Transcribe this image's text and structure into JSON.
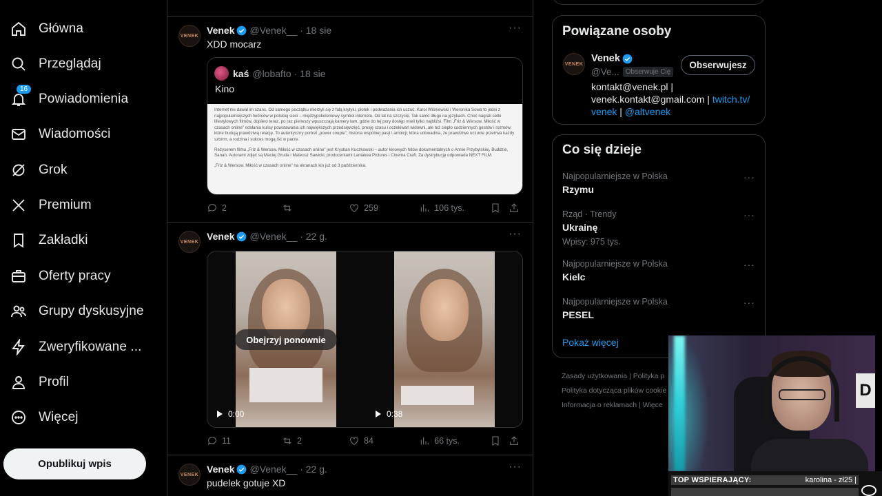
{
  "nav": {
    "items": [
      {
        "label": "Główna",
        "icon": "home-icon"
      },
      {
        "label": "Przeglądaj",
        "icon": "search-icon"
      },
      {
        "label": "Powiadomienia",
        "icon": "bell-icon",
        "badge": "16"
      },
      {
        "label": "Wiadomości",
        "icon": "mail-icon"
      },
      {
        "label": "Grok",
        "icon": "grok-icon"
      },
      {
        "label": "Premium",
        "icon": "x-logo-icon"
      },
      {
        "label": "Zakładki",
        "icon": "bookmark-icon"
      },
      {
        "label": "Oferty pracy",
        "icon": "briefcase-icon"
      },
      {
        "label": "Grupy dyskusyjne",
        "icon": "people-icon"
      },
      {
        "label": "Zweryfikowane ...",
        "icon": "lightning-icon"
      },
      {
        "label": "Profil",
        "icon": "person-icon"
      },
      {
        "label": "Więcej",
        "icon": "more-circle-icon"
      }
    ],
    "publish_label": "Opublikuj wpis"
  },
  "tweets": [
    {
      "avatar_text": "VENEK",
      "name": "Venek",
      "handle": "@Venek__",
      "time": "· 18 sie",
      "text": "XDD mocarz",
      "quote": {
        "name": "kaś",
        "handle": "@lobafto",
        "time": "· 18 sie",
        "text": "Kino",
        "doc_p1": "Internet nie dawał im szans. Od samego początku mierzyli się z falą krytyki, plotek i podważania ich uczuć. Karol Wiśniewski i Weronika Sowa to jedni z najpopularniejszych twórców w polskiej sieci – międzypokoleniowy symbol internetu. Od lat na szczycie. Tak samo długo na językach. Choć nagrali setki lifestylowych filmów, dopiero teraz, po raz pierwszy wpuszczają kamery tam, gdzie do tej pory dostęp mieli tylko najbliżsi. Film „Friz & Wersow. Miłość w czasach online” odsłania kulisy powstawania ich największych przedsięwzięć, presję czasu i oczekiwań widowni, ale też ciepło codziennych gestów i rozmów, które budują prawdziwą relację. To autentyczny portret „power couple”, historia wspólnej pasji i ambicji, która udowadnia, że prawdziwe uczucie przetrwa każdy sztorm, a rodzina i sukces mogą iść w parze.",
        "doc_p2": "Reżyserem filmu „Friz & Wersow. Miłość w czasach online” jest Krystian Kuczkowski – autor kinowych hitów dokumentalnych o Annie Przybylskiej, Buddzie, Sanah. Autorami zdjęć są Maciej Gruda i Mateusz Sawicki, producentami Laniakea Pictures i Cinema Craft. Za dystrybucję odpowiada NEXT FILM.",
        "doc_p3": "„Friz & Wersow. Miłość w czasach online” na ekranach kin już od 3 października."
      },
      "replies": "2",
      "retweets": "",
      "likes": "259",
      "views": "106 tys."
    },
    {
      "avatar_text": "VENEK",
      "name": "Venek",
      "handle": "@Venek__",
      "time": "· 22 g.",
      "video1_time": "0:00",
      "video2_time": "0:38",
      "replay_label": "Obejrzyj ponownie",
      "replies": "11",
      "retweets": "2",
      "likes": "84",
      "views": "66 tys."
    },
    {
      "avatar_text": "VENEK",
      "name": "Venek",
      "handle": "@Venek__",
      "time": "· 22 g.",
      "text": "pudelek gotuje XD"
    }
  ],
  "related": {
    "title": "Powiązane osoby",
    "name": "Venek",
    "handle": "@Ve...",
    "follows_you": "Obserwuje Cię",
    "follow_label": "Obserwujesz",
    "bio_line1": "kontakt@venek.pl |",
    "bio_line2": "venek.kontakt@gmail.com | ",
    "bio_link1": "twitch.tv/",
    "bio_link1b": "venek",
    "bio_sep": " | ",
    "bio_link2": "@altvenek"
  },
  "trends": {
    "title": "Co się dzieje",
    "items": [
      {
        "meta": "Najpopularniejsze w Polska",
        "title": "Rzymu",
        "sub": ""
      },
      {
        "meta": "Rząd · Trendy",
        "title": "Ukrainę",
        "sub": "Wpisy: 975 tys."
      },
      {
        "meta": "Najpopularniejsze w Polska",
        "title": "Kielc",
        "sub": ""
      },
      {
        "meta": "Najpopularniejsze w Polska",
        "title": "PESEL",
        "sub": ""
      }
    ],
    "show_more": "Pokaż więcej"
  },
  "footer": {
    "line1": "Zasady użytkowania  |  Polityka p",
    "line2": "Polityka dotycząca plików cookie",
    "line3": "Informacja o reklamach  |  Więce"
  },
  "stream": {
    "label": "TOP WSPIERAJĄCY:",
    "supporter": "karolina - zł25 |",
    "sign_text": "D"
  },
  "colors": {
    "accent": "#1d9bf0",
    "background": "#000000",
    "border": "#2f3336",
    "muted": "#71767b"
  }
}
